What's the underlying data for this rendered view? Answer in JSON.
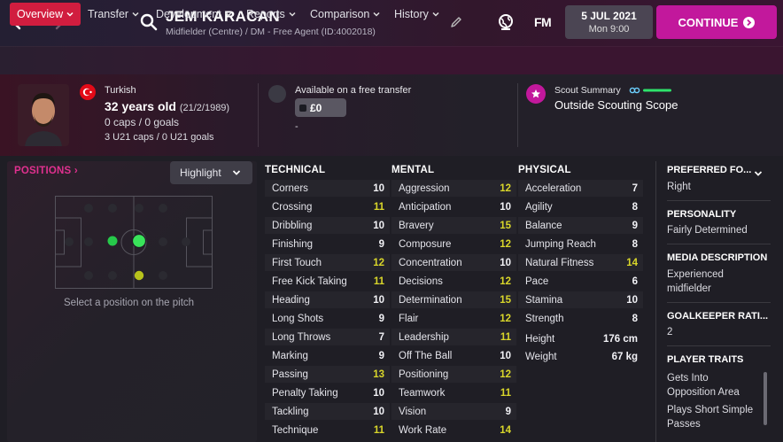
{
  "header": {
    "player_name": "JEM KARACAN",
    "player_sub": "Midfielder (Centre) / DM - Free Agent (ID:4002018)",
    "fm_logo": "FM",
    "date_main": "5 JUL 2021",
    "date_sub": "Mon 9:00",
    "continue_label": "CONTINUE"
  },
  "tabs": [
    {
      "label": "Overview",
      "active": true
    },
    {
      "label": "Transfer"
    },
    {
      "label": "Development"
    },
    {
      "label": "Reports"
    },
    {
      "label": "Comparison"
    },
    {
      "label": "History"
    }
  ],
  "profile": {
    "nationality": "Turkish",
    "age": "32 years old",
    "dob": "(21/2/1989)",
    "caps": "0 caps / 0 goals",
    "u21caps": "3 U21 caps / 0 U21 goals",
    "transfer_status": "Available on a free transfer",
    "value": "£0",
    "value_sub": "-",
    "scout_label": "Scout Summary",
    "scout_value": "Outside Scouting Scope"
  },
  "positions": {
    "title": "POSITIONS",
    "highlight_label": "Highlight",
    "hint": "Select a position on the pitch"
  },
  "technical": {
    "title": "TECHNICAL",
    "rows": [
      {
        "name": "Corners",
        "value": "10"
      },
      {
        "name": "Crossing",
        "value": "11"
      },
      {
        "name": "Dribbling",
        "value": "10"
      },
      {
        "name": "Finishing",
        "value": "9"
      },
      {
        "name": "First Touch",
        "value": "12"
      },
      {
        "name": "Free Kick Taking",
        "value": "11"
      },
      {
        "name": "Heading",
        "value": "10"
      },
      {
        "name": "Long Shots",
        "value": "9"
      },
      {
        "name": "Long Throws",
        "value": "7"
      },
      {
        "name": "Marking",
        "value": "9"
      },
      {
        "name": "Passing",
        "value": "13"
      },
      {
        "name": "Penalty Taking",
        "value": "10"
      },
      {
        "name": "Tackling",
        "value": "10"
      },
      {
        "name": "Technique",
        "value": "11"
      }
    ]
  },
  "mental": {
    "title": "MENTAL",
    "rows": [
      {
        "name": "Aggression",
        "value": "12"
      },
      {
        "name": "Anticipation",
        "value": "10"
      },
      {
        "name": "Bravery",
        "value": "15"
      },
      {
        "name": "Composure",
        "value": "12"
      },
      {
        "name": "Concentration",
        "value": "10"
      },
      {
        "name": "Decisions",
        "value": "12"
      },
      {
        "name": "Determination",
        "value": "15"
      },
      {
        "name": "Flair",
        "value": "12"
      },
      {
        "name": "Leadership",
        "value": "11"
      },
      {
        "name": "Off The Ball",
        "value": "10"
      },
      {
        "name": "Positioning",
        "value": "12"
      },
      {
        "name": "Teamwork",
        "value": "11"
      },
      {
        "name": "Vision",
        "value": "9"
      },
      {
        "name": "Work Rate",
        "value": "14"
      }
    ]
  },
  "physical": {
    "title": "PHYSICAL",
    "rows": [
      {
        "name": "Acceleration",
        "value": "7"
      },
      {
        "name": "Agility",
        "value": "8"
      },
      {
        "name": "Balance",
        "value": "9"
      },
      {
        "name": "Jumping Reach",
        "value": "8"
      },
      {
        "name": "Natural Fitness",
        "value": "14"
      },
      {
        "name": "Pace",
        "value": "6"
      },
      {
        "name": "Stamina",
        "value": "10"
      },
      {
        "name": "Strength",
        "value": "8"
      }
    ],
    "height_label": "Height",
    "height_value": "176 cm",
    "weight_label": "Weight",
    "weight_value": "67 kg"
  },
  "sidebar": {
    "preferred_foot_title": "PREFERRED FO...",
    "preferred_foot": "Right",
    "personality_title": "PERSONALITY",
    "personality": "Fairly Determined",
    "media_title": "MEDIA DESCRIPTION",
    "media": "Experienced midfielder",
    "gk_title": "GOALKEEPER RATI...",
    "gk": "2",
    "traits_title": "PLAYER TRAITS",
    "trait_1": "Gets Into Opposition Area",
    "trait_2": "Plays Short Simple Passes"
  },
  "colors": {
    "accent": "#c2189c",
    "active_tab": "#d11d3f",
    "highlight_value": "#d9d62a",
    "positions_title": "#e0308f"
  }
}
